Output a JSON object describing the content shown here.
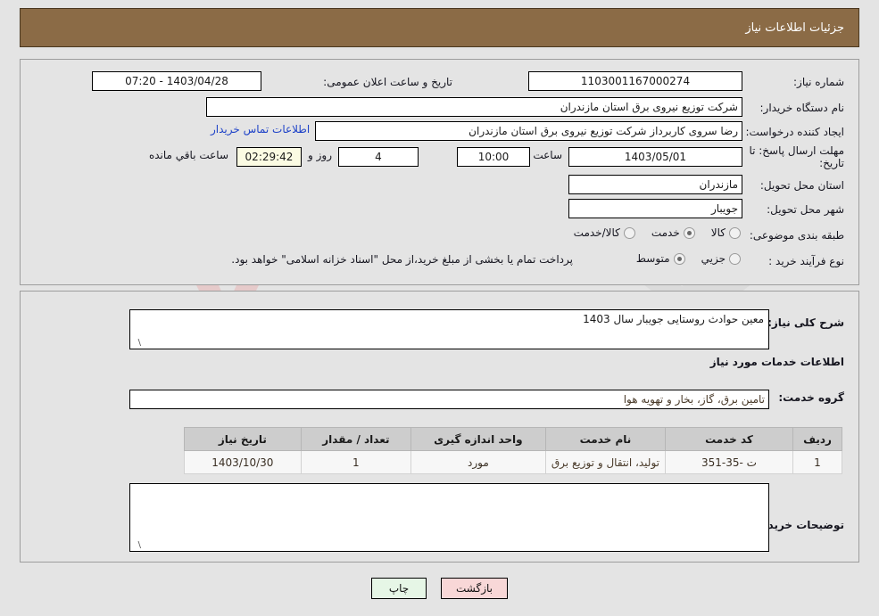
{
  "header": {
    "title": "جزئیات اطلاعات نیاز"
  },
  "watermark": {
    "text": "AriaTender.net"
  },
  "form": {
    "need_number_label": "شماره نیاز:",
    "need_number_value": "1103001167000274",
    "public_announce_label": "تاریخ و ساعت اعلان عمومی:",
    "public_announce_value": "1403/04/28 - 07:20",
    "buyer_org_label": "نام دستگاه خریدار:",
    "buyer_org_value": "شرکت توزیع نیروی برق استان مازندران",
    "creator_label": "ایجاد کننده درخواست:",
    "creator_value": "رضا سروی کاربرداز شرکت توزیع نیروی برق استان مازندران",
    "contact_link": "اطلاعات تماس خریدار",
    "deadline_label": "مهلت ارسال پاسخ: تا تاریخ:",
    "deadline_date": "1403/05/01",
    "deadline_hour_label": "ساعت",
    "deadline_hour_value": "10:00",
    "days_value": "4",
    "days_label": "روز و",
    "countdown_value": "02:29:42",
    "countdown_label": "ساعت باقي مانده",
    "province_label": "استان محل تحویل:",
    "province_value": "مازندران",
    "city_label": "شهر محل تحویل:",
    "city_value": "جویبار",
    "category_label": "طبقه بندی موضوعی:",
    "category_options": [
      {
        "label": "کالا",
        "selected": false
      },
      {
        "label": "خدمت",
        "selected": true
      },
      {
        "label": "کالا/خدمت",
        "selected": false
      }
    ],
    "process_label": "نوع فرآیند خرید :",
    "process_options": [
      {
        "label": "جزیي",
        "selected": false
      },
      {
        "label": "متوسط",
        "selected": true
      }
    ],
    "payment_note": "پرداخت تمام یا بخشی از مبلغ خرید،از محل \"اسناد خزانه اسلامی\" خواهد بود."
  },
  "middle": {
    "general_desc_label": "شرح کلی نیاز:",
    "general_desc_value": "معین حوادث روستایی جویبار سال 1403",
    "services_section_title": "اطلاعات خدمات مورد نیاز",
    "service_group_label": "گروه خدمت:",
    "service_group_value": "تامین برق، گاز، بخار و تهویه هوا",
    "buyer_notes_label": "توضیحات خریدار:",
    "buyer_notes_value": ""
  },
  "table": {
    "columns": [
      "ردیف",
      "کد خدمت",
      "نام خدمت",
      "واحد اندازه گیری",
      "تعداد / مقدار",
      "تاریخ نیاز"
    ],
    "rows": [
      {
        "radif": "1",
        "code": "ت -35-351",
        "name": "تولید، انتقال و توزیع برق",
        "unit": "مورد",
        "qty": "1",
        "date": "1403/10/30"
      }
    ]
  },
  "buttons": {
    "print": "چاپ",
    "back": "بازگشت"
  }
}
